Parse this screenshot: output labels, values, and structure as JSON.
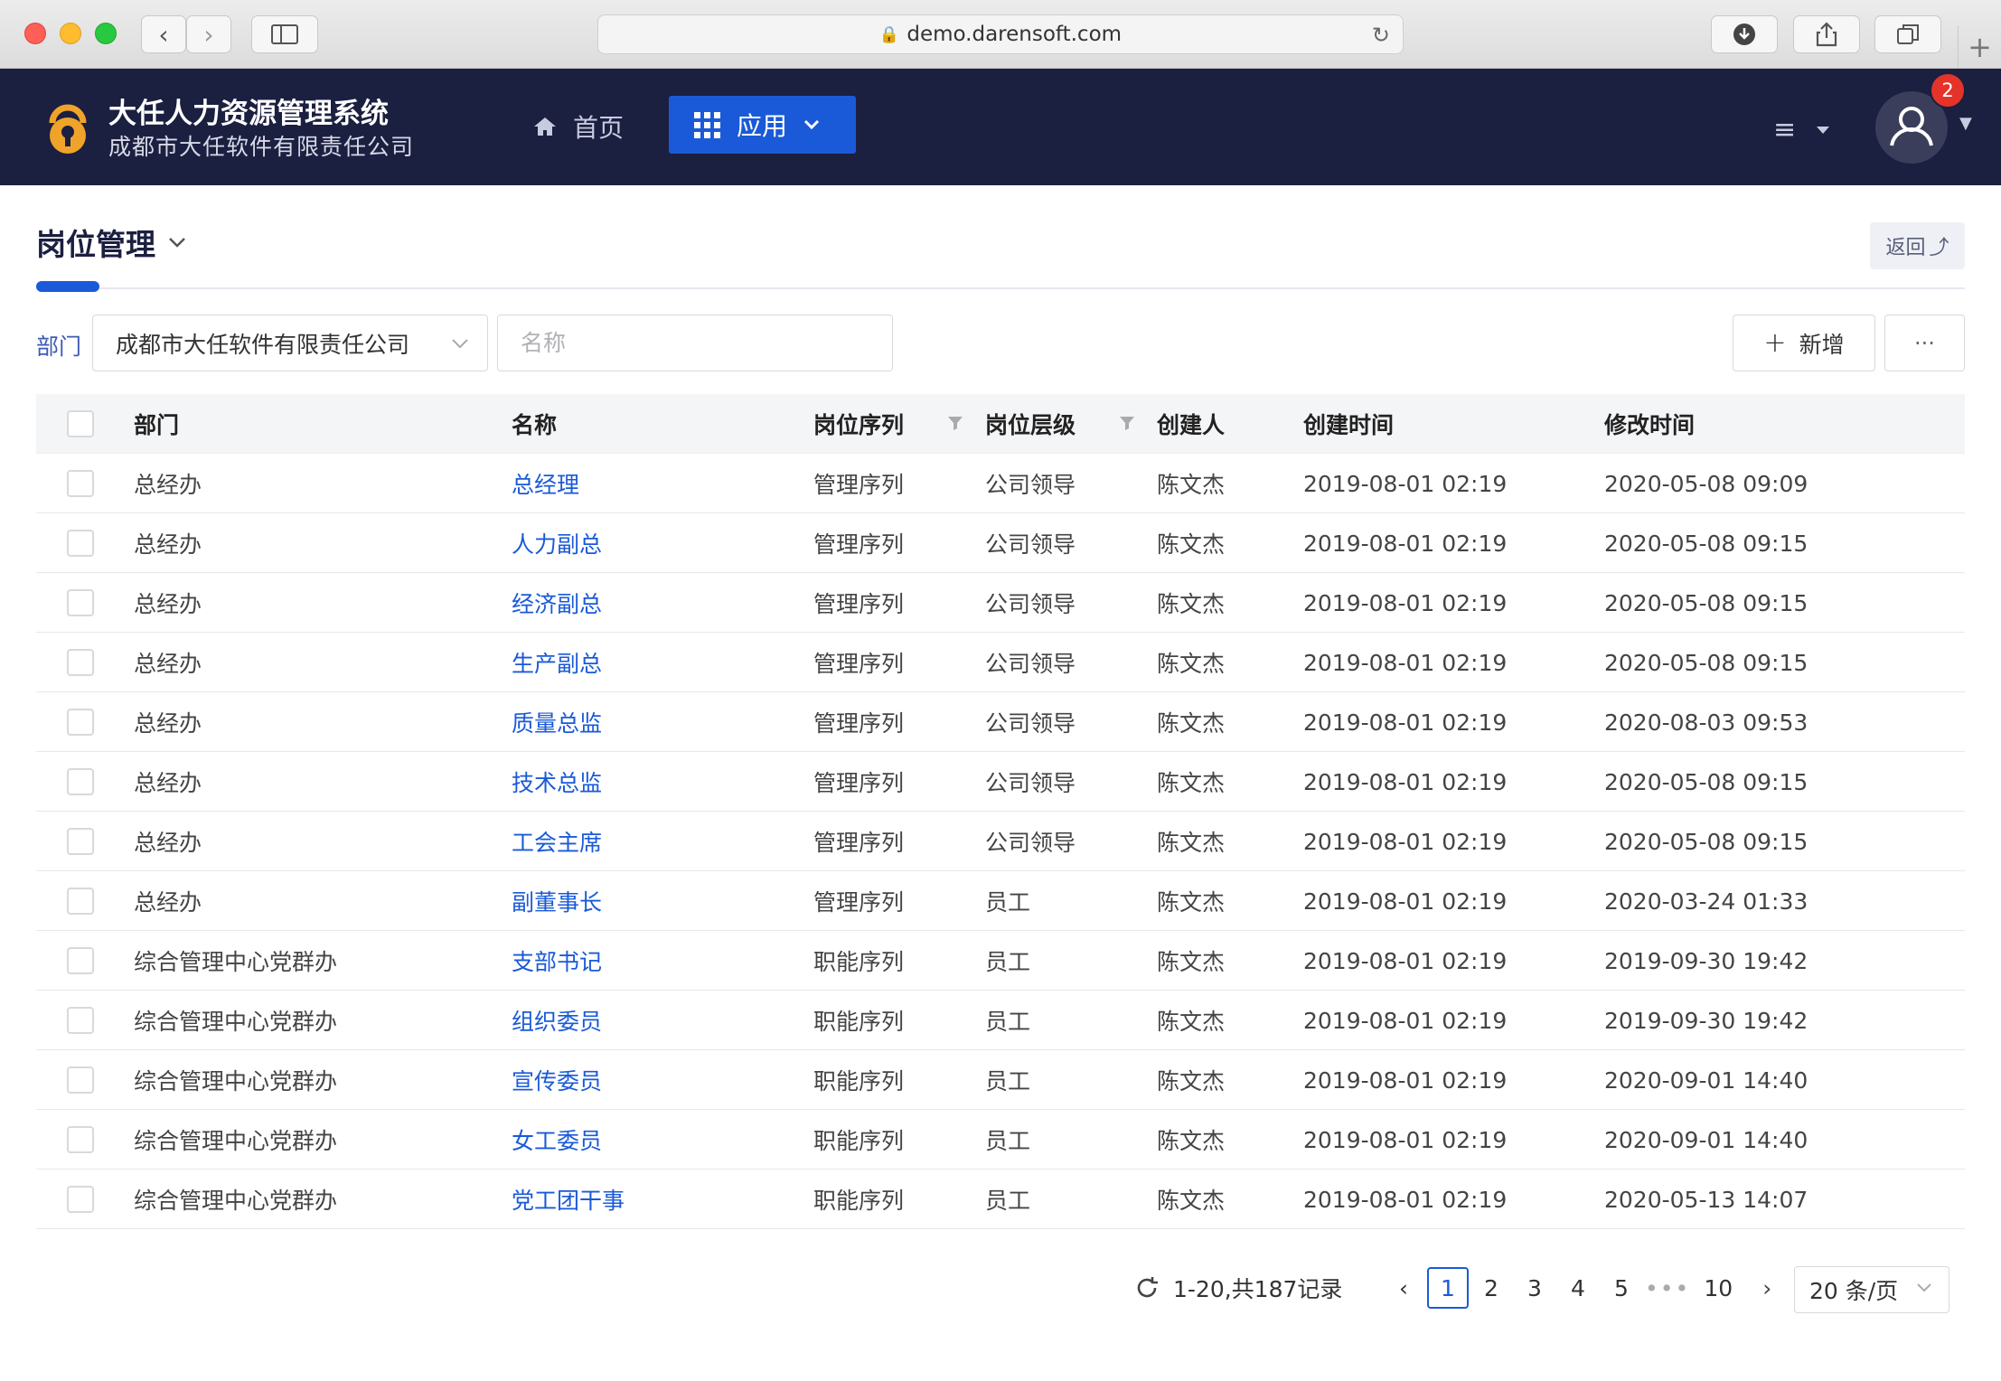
{
  "browser": {
    "url": "demo.darensoft.com"
  },
  "header": {
    "title": "大任人力资源管理系统",
    "subtitle": "成都市大任软件有限责任公司",
    "nav_home": "首页",
    "nav_app": "应用",
    "notification_count": "2"
  },
  "page": {
    "title": "岗位管理",
    "back_label": "返回",
    "filter_dept_label": "部门",
    "filter_dept_value": "成都市大任软件有限责任公司",
    "filter_name_placeholder": "名称",
    "add_label": "新增",
    "more_label": "···"
  },
  "table": {
    "columns": {
      "dept": "部门",
      "name": "名称",
      "seq": "岗位序列",
      "level": "岗位层级",
      "creator": "创建人",
      "ctime": "创建时间",
      "mtime": "修改时间"
    },
    "rows": [
      {
        "dept": "总经办",
        "name": "总经理",
        "seq": "管理序列",
        "level": "公司领导",
        "creator": "陈文杰",
        "ctime": "2019-08-01 02:19",
        "mtime": "2020-05-08 09:09"
      },
      {
        "dept": "总经办",
        "name": "人力副总",
        "seq": "管理序列",
        "level": "公司领导",
        "creator": "陈文杰",
        "ctime": "2019-08-01 02:19",
        "mtime": "2020-05-08 09:15"
      },
      {
        "dept": "总经办",
        "name": "经济副总",
        "seq": "管理序列",
        "level": "公司领导",
        "creator": "陈文杰",
        "ctime": "2019-08-01 02:19",
        "mtime": "2020-05-08 09:15"
      },
      {
        "dept": "总经办",
        "name": "生产副总",
        "seq": "管理序列",
        "level": "公司领导",
        "creator": "陈文杰",
        "ctime": "2019-08-01 02:19",
        "mtime": "2020-05-08 09:15"
      },
      {
        "dept": "总经办",
        "name": "质量总监",
        "seq": "管理序列",
        "level": "公司领导",
        "creator": "陈文杰",
        "ctime": "2019-08-01 02:19",
        "mtime": "2020-08-03 09:53"
      },
      {
        "dept": "总经办",
        "name": "技术总监",
        "seq": "管理序列",
        "level": "公司领导",
        "creator": "陈文杰",
        "ctime": "2019-08-01 02:19",
        "mtime": "2020-05-08 09:15"
      },
      {
        "dept": "总经办",
        "name": "工会主席",
        "seq": "管理序列",
        "level": "公司领导",
        "creator": "陈文杰",
        "ctime": "2019-08-01 02:19",
        "mtime": "2020-05-08 09:15"
      },
      {
        "dept": "总经办",
        "name": "副董事长",
        "seq": "管理序列",
        "level": "员工",
        "creator": "陈文杰",
        "ctime": "2019-08-01 02:19",
        "mtime": "2020-03-24 01:33"
      },
      {
        "dept": "综合管理中心党群办",
        "name": "支部书记",
        "seq": "职能序列",
        "level": "员工",
        "creator": "陈文杰",
        "ctime": "2019-08-01 02:19",
        "mtime": "2019-09-30 19:42"
      },
      {
        "dept": "综合管理中心党群办",
        "name": "组织委员",
        "seq": "职能序列",
        "level": "员工",
        "creator": "陈文杰",
        "ctime": "2019-08-01 02:19",
        "mtime": "2019-09-30 19:42"
      },
      {
        "dept": "综合管理中心党群办",
        "name": "宣传委员",
        "seq": "职能序列",
        "level": "员工",
        "creator": "陈文杰",
        "ctime": "2019-08-01 02:19",
        "mtime": "2020-09-01 14:40"
      },
      {
        "dept": "综合管理中心党群办",
        "name": "女工委员",
        "seq": "职能序列",
        "level": "员工",
        "creator": "陈文杰",
        "ctime": "2019-08-01 02:19",
        "mtime": "2020-09-01 14:40"
      },
      {
        "dept": "综合管理中心党群办",
        "name": "党工团干事",
        "seq": "职能序列",
        "level": "员工",
        "creator": "陈文杰",
        "ctime": "2019-08-01 02:19",
        "mtime": "2020-05-13 14:07"
      }
    ]
  },
  "pagination": {
    "summary": "1-20,共187记录",
    "pages": [
      "1",
      "2",
      "3",
      "4",
      "5"
    ],
    "ellipsis": "•••",
    "last_page": "10",
    "current": "1",
    "page_size": "20 条/页"
  },
  "colors": {
    "header_bg": "#1b1f40",
    "accent": "#1a5ad8",
    "badge": "#e5332a"
  }
}
